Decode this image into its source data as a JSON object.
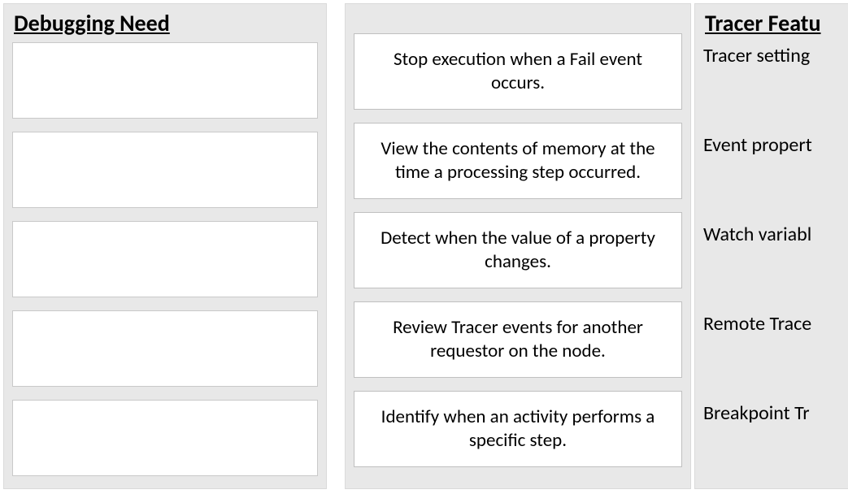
{
  "left": {
    "heading": "Debugging Need"
  },
  "middle": {
    "cards": [
      {
        "text": "Stop execution when a Fail event occurs."
      },
      {
        "text": "View the contents of memory at the time a  processing step occurred."
      },
      {
        "text": "Detect when the value of a property changes."
      },
      {
        "text": "Review Tracer events for another requestor on the node."
      },
      {
        "text": "Identify when an activity performs a specific step."
      }
    ]
  },
  "right": {
    "heading": "Tracer Featu",
    "features": [
      {
        "label": "Tracer setting"
      },
      {
        "label": "Event propert"
      },
      {
        "label": "Watch variabl"
      },
      {
        "label": "Remote Trace"
      },
      {
        "label": "Breakpoint Tr"
      }
    ]
  }
}
